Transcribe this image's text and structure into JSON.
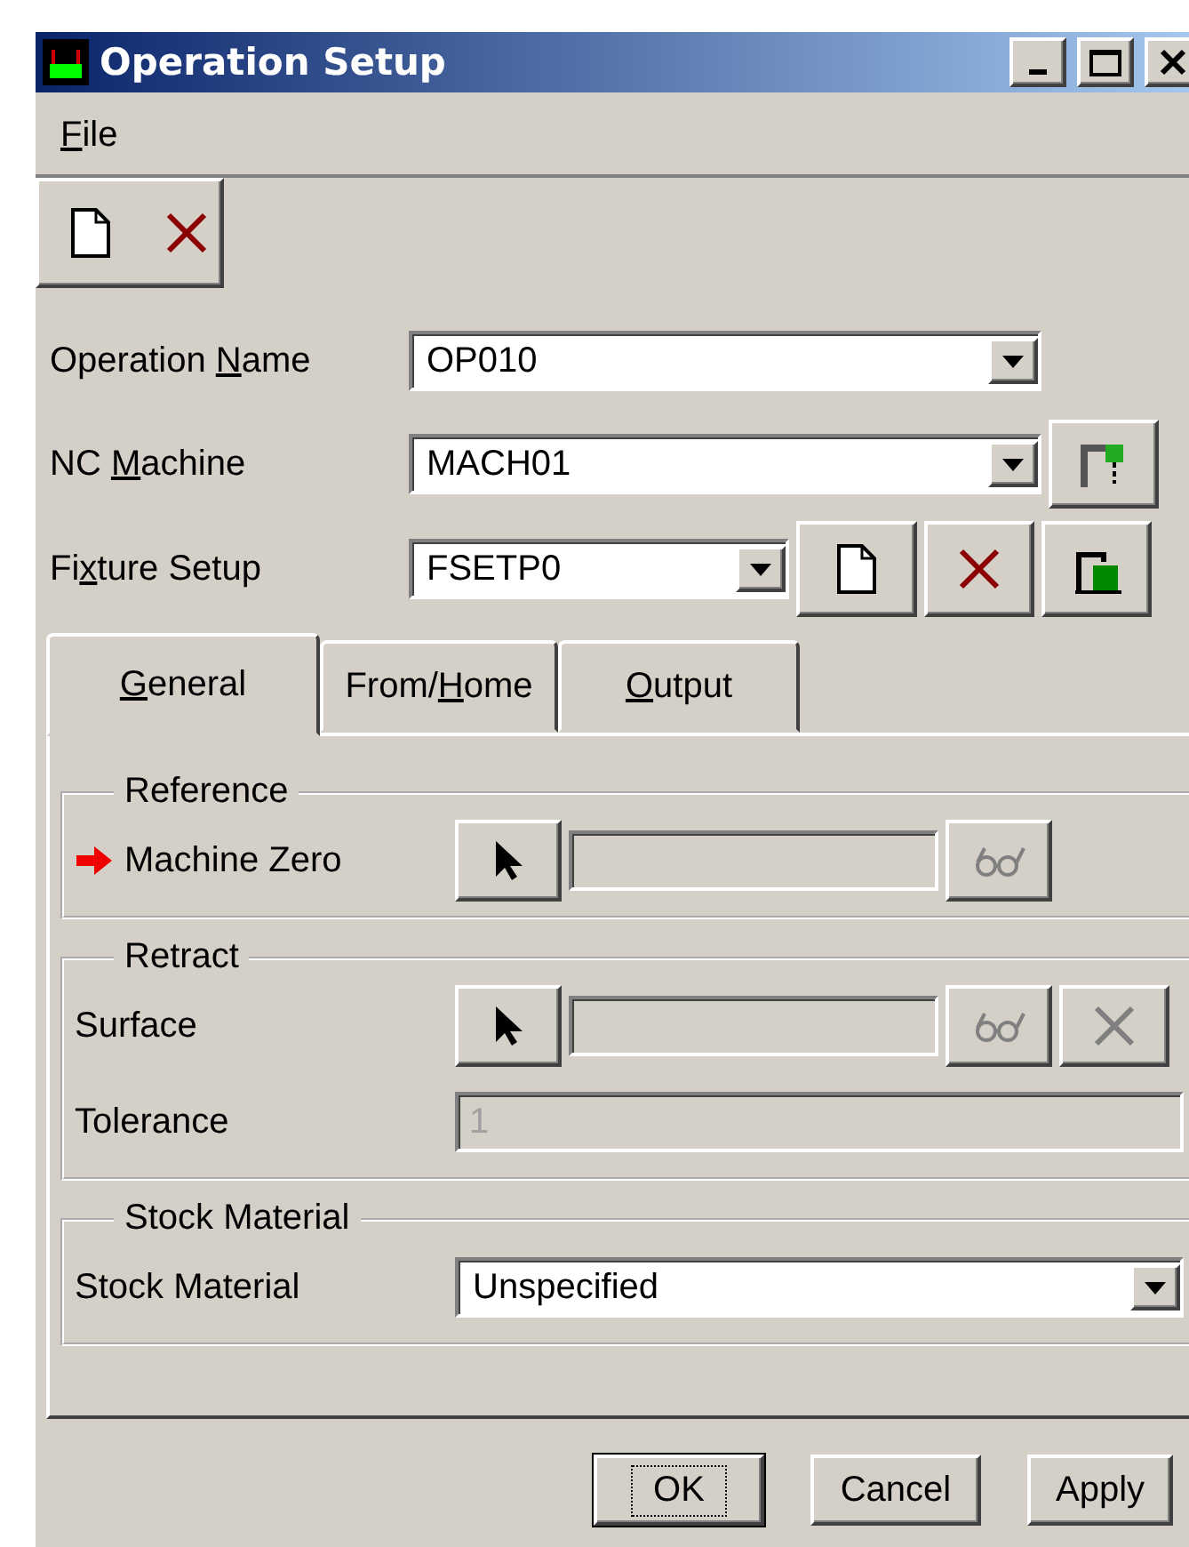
{
  "window": {
    "title": "Operation Setup"
  },
  "menu": [
    {
      "key": "F",
      "post": "ile"
    }
  ],
  "toolbar": [
    {
      "kind": "new"
    },
    {
      "kind": "delete"
    }
  ],
  "fields": [
    {
      "pre": "Operation ",
      "key": "N",
      "post": "ame",
      "value": "OP010"
    },
    {
      "pre": "NC ",
      "key": "M",
      "post": "achine",
      "value": "MACH01",
      "buttons": [
        {
          "kind": "machine"
        }
      ]
    },
    {
      "pre": "Fi",
      "key": "x",
      "post": "ture Setup",
      "value": "FSETP0",
      "buttons": [
        {
          "kind": "new"
        },
        {
          "kind": "delete"
        },
        {
          "kind": "fixture"
        }
      ]
    }
  ],
  "tabs": [
    {
      "key": "G",
      "post": "eneral",
      "selected": true
    },
    {
      "pre": "From/",
      "key": "H",
      "post": "ome",
      "selected": false
    },
    {
      "key": "O",
      "post": "utput",
      "selected": false
    }
  ],
  "groups": [
    {
      "title": "Reference",
      "rows": [
        {
          "kind": "select",
          "label": "Machine Zero",
          "required": true,
          "value_disabled": true,
          "buttons": [
            {
              "kind": "view",
              "disabled": true
            }
          ]
        }
      ]
    },
    {
      "title": "Retract",
      "rows": [
        {
          "kind": "select",
          "label": "Surface",
          "required": false,
          "value_disabled": true,
          "buttons": [
            {
              "kind": "view",
              "disabled": true
            },
            {
              "kind": "clear",
              "disabled": true
            }
          ]
        },
        {
          "kind": "text",
          "label": "Tolerance",
          "value": "1",
          "disabled": true
        }
      ]
    },
    {
      "title": "Stock Material",
      "rows": [
        {
          "kind": "combo",
          "label": "Stock Material",
          "value": "Unspecified"
        }
      ]
    }
  ],
  "dialog_buttons": [
    {
      "label": "OK",
      "focused": true
    },
    {
      "label": "Cancel",
      "focused": false
    },
    {
      "label": "Apply",
      "focused": false
    }
  ]
}
